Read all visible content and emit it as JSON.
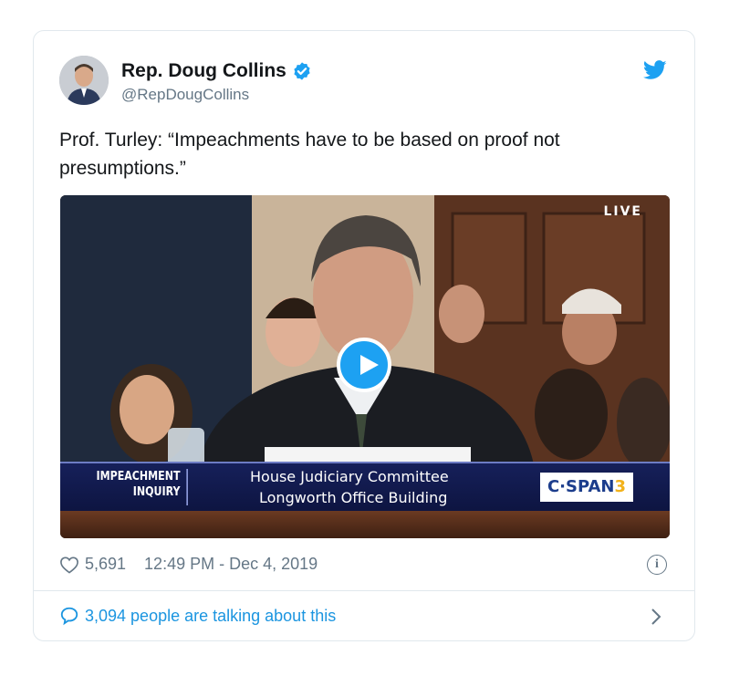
{
  "tweet": {
    "author_name": "Rep. Doug Collins",
    "handle": "@RepDougCollins",
    "text_line1": "Prof. Turley: “Impeachments have to be based on proof not",
    "text_line2": "presumptions.”",
    "likes": "5,691",
    "timestamp": "12:49 PM - Dec 4, 2019",
    "talking": "3,094 people are talking about this"
  },
  "video": {
    "live_label": "LIVE",
    "chyron_tag_line1": "IMPEACHMENT",
    "chyron_tag_line2": "INQUIRY",
    "chyron_line1": "House Judiciary Committee",
    "chyron_line2": "Longworth Office Building",
    "network_text": "C·SPAN",
    "network_number": "3"
  },
  "colors": {
    "twitter_blue": "#1da1f2",
    "link_blue": "#1b95e0",
    "secondary_text": "#657786",
    "chyron_navy": "#16205a"
  },
  "icons": {
    "verified": "verified-badge-icon",
    "logo": "twitter-bird-icon",
    "like": "heart-icon",
    "info": "info-icon",
    "reply": "speech-bubble-icon",
    "more": "chevron-right-icon",
    "play": "play-icon"
  }
}
